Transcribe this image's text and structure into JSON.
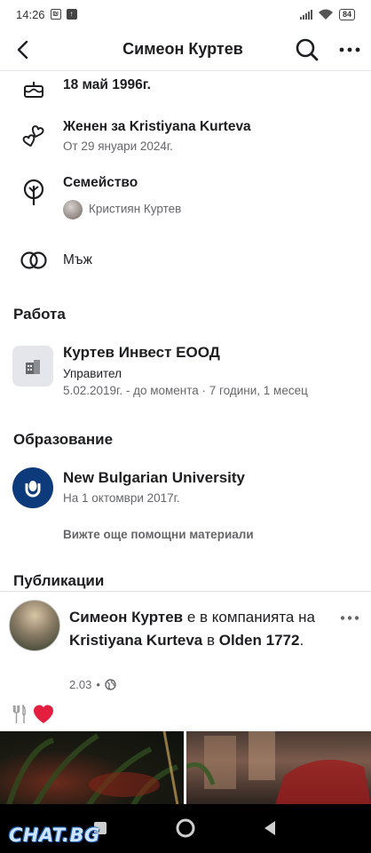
{
  "status_bar": {
    "time": "14:26",
    "battery": "84"
  },
  "header": {
    "title": "Симеон Куртев"
  },
  "about": {
    "birthday": "18 май 1996г.",
    "relationship": {
      "title": "Женен за Kristiyana Kurteva",
      "since": "От 29 януари 2024г."
    },
    "family": {
      "title": "Семейство",
      "member": "Кристиян Куртев"
    },
    "gender": "Мъж"
  },
  "work": {
    "section_title": "Работа",
    "company": "Куртев Инвест ЕООД",
    "role": "Управител",
    "period": "5.02.2019г. - до момента · 7 години, 1 месец"
  },
  "education": {
    "section_title": "Образование",
    "school": "New Bulgarian University",
    "date": "На 1 октомври 2017г.",
    "see_more": "Вижте още помощни материали"
  },
  "posts": {
    "section_title": "Публикации",
    "post": {
      "author": "Симеон Куртев",
      "text_1": " е в компанията на ",
      "tagged": "Kristiyana Kurteva",
      "text_2": " в ",
      "place": "Olden 1772",
      "text_3": ".",
      "date": "2.03",
      "separator": "•"
    }
  },
  "watermark": "CHAT.BG",
  "colors": {
    "text_primary": "#1c1e21",
    "text_secondary": "#65676b",
    "divider": "#dfe1e5",
    "nbu_blue": "#0d3a7a",
    "heart": "#e41e3f"
  }
}
